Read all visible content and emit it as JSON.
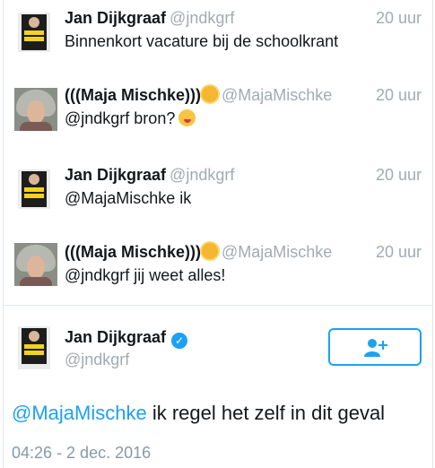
{
  "tweets": [
    {
      "name": "Jan Dijkgraaf",
      "handle": "@jndkgrf",
      "time": "20 uur",
      "text": "Binnenkort vacature bij de schoolkrant",
      "avatar": "book-cover-avatar"
    },
    {
      "name": "(((Maja Mischke)))",
      "handle": "@MajaMischke",
      "time": "20 uur",
      "text": "@jndkgrf bron?",
      "avatar": "photo-avatar",
      "name_emoji": "sun-emoji",
      "text_emoji": "winking-tongue-emoji"
    },
    {
      "name": "Jan Dijkgraaf",
      "handle": "@jndkgrf",
      "time": "20 uur",
      "text": "@MajaMischke ik",
      "avatar": "book-cover-avatar"
    },
    {
      "name": "(((Maja Mischke)))",
      "handle": "@MajaMischke",
      "time": "20 uur",
      "text": "@jndkgrf jij weet alles!",
      "avatar": "photo-avatar",
      "name_emoji": "sun-emoji"
    }
  ],
  "detail": {
    "name": "Jan Dijkgraaf",
    "handle": "@jndkgrf",
    "verified_icon": "verified-badge-icon",
    "follow_icon": "add-person-icon",
    "mention": "@MajaMischke",
    "text": " ik regel het zelf in dit geval",
    "timestamp": "04:26 - 2 dec. 2016"
  },
  "colors": {
    "accent": "#1da1f2",
    "muted": "#a2aab2",
    "text": "#14171a",
    "divider": "#e1e8ed"
  }
}
